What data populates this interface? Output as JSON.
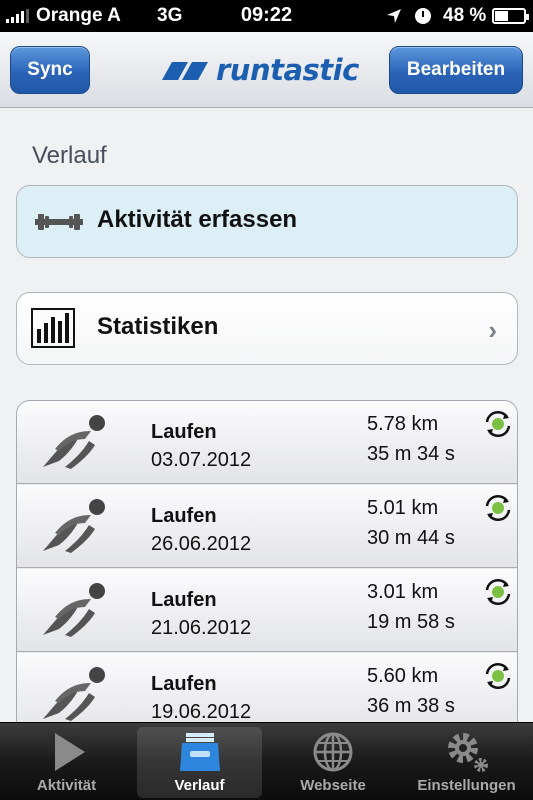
{
  "status_bar": {
    "carrier": "Orange A",
    "network": "3G",
    "time": "09:22",
    "battery_percent": "48 %",
    "battery_level": 0.48,
    "signal_bars": 4
  },
  "nav_bar": {
    "left_button": "Sync",
    "right_button": "Bearbeiten",
    "logo_text": "runtastic"
  },
  "main": {
    "title": "Verlauf",
    "record_activity_label": "Aktivität erfassen",
    "statistics_label": "Statistiken",
    "statistics_chevron": "›"
  },
  "activities": [
    {
      "type": "Laufen",
      "date": "03.07.2012",
      "distance": "5.78 km",
      "duration": "35 m 34 s",
      "icon": "runner-icon"
    },
    {
      "type": "Laufen",
      "date": "26.06.2012",
      "distance": "5.01 km",
      "duration": "30 m 44 s",
      "icon": "runner-icon"
    },
    {
      "type": "Laufen",
      "date": "21.06.2012",
      "distance": "3.01 km",
      "duration": "19 m 58 s",
      "icon": "runner-icon"
    },
    {
      "type": "Laufen",
      "date": "19.06.2012",
      "distance": "5.60 km",
      "duration": "36 m 38 s",
      "icon": "runner-icon"
    }
  ],
  "tab_bar": {
    "tabs": [
      {
        "label": "Aktivität",
        "icon": "play-icon",
        "active": false
      },
      {
        "label": "Verlauf",
        "icon": "inbox-icon",
        "active": true
      },
      {
        "label": "Webseite",
        "icon": "globe-icon",
        "active": false
      },
      {
        "label": "Einstellungen",
        "icon": "gear-icon",
        "active": false
      }
    ]
  },
  "colors": {
    "accent_blue": "#2b64b7",
    "sync_green": "#7bc043",
    "record_card_bg": "#ddeff6"
  }
}
